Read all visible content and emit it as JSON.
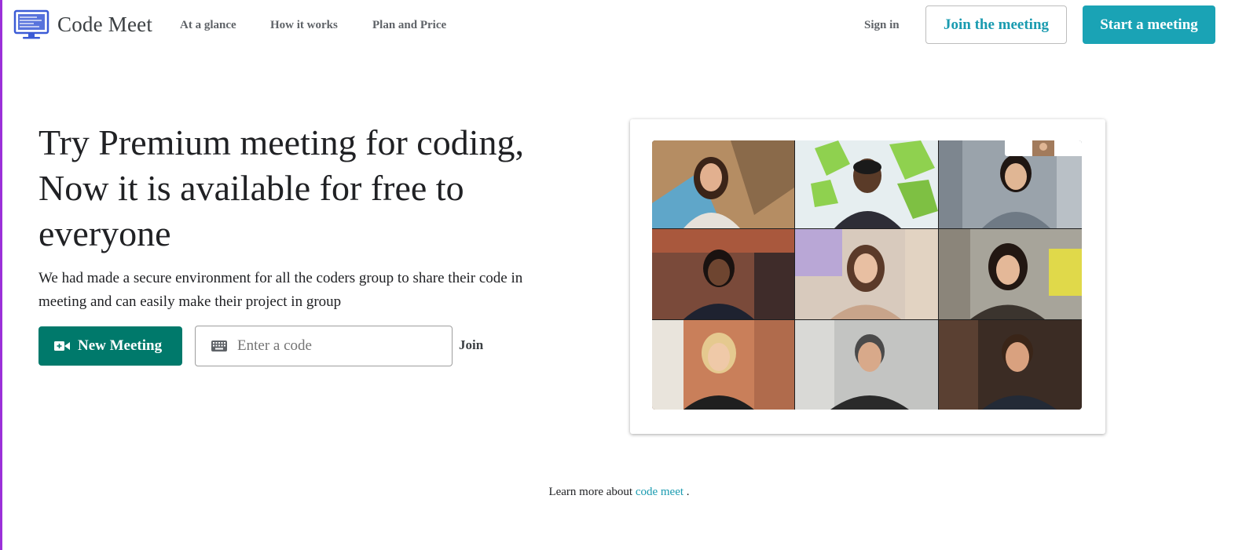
{
  "brand": {
    "name": "Code Meet",
    "icon": "monitor-icon"
  },
  "nav": [
    {
      "label": "At a glance"
    },
    {
      "label": "How it works"
    },
    {
      "label": "Plan and Price"
    }
  ],
  "header_actions": {
    "sign_in": "Sign in",
    "join_meeting": "Join the meeting",
    "start_meeting": "Start a meeting"
  },
  "hero": {
    "title_line1": "Try Premium meeting for coding,",
    "title_line2": "Now it is available for free to",
    "title_line3": "everyone",
    "description_line1": "We had made a secure environment for all the coders group to share their code in",
    "description_line2": "meeting and can easily make their project in group"
  },
  "actions": {
    "new_meeting": "New Meeting",
    "new_meeting_icon": "video-camera-icon",
    "code_placeholder": "Enter a code",
    "code_value": "",
    "code_icon": "keyboard-icon",
    "join": "Join"
  },
  "footer": {
    "learn_prefix": "Learn more about",
    "learn_link": "code meet",
    "learn_suffix": "."
  },
  "colors": {
    "accent_teal": "#1aa3b5",
    "new_meeting_green": "#00796b",
    "left_border": "#9b30d9"
  }
}
